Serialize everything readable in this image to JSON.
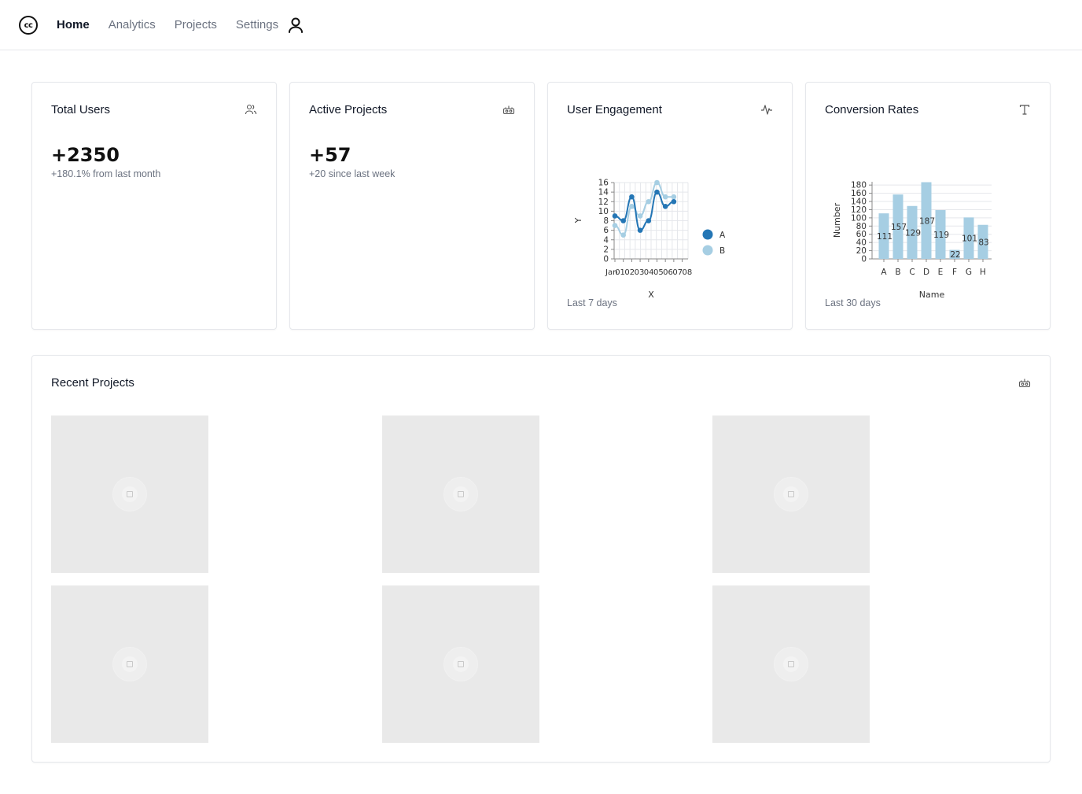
{
  "logo": {
    "text": "cc"
  },
  "nav": {
    "items": [
      {
        "label": "Home",
        "active": true
      },
      {
        "label": "Analytics",
        "active": false
      },
      {
        "label": "Projects",
        "active": false
      },
      {
        "label": "Settings",
        "active": false
      }
    ]
  },
  "cards": {
    "total_users": {
      "title": "Total Users",
      "value": "+2350",
      "sub": "+180.1% from last month",
      "icon": "users-icon"
    },
    "active_projects": {
      "title": "Active Projects",
      "value": "+57",
      "sub": "+20 since last week",
      "icon": "projects-icon"
    },
    "user_engagement": {
      "title": "User Engagement",
      "foot": "Last 7 days",
      "icon": "activity-icon"
    },
    "conversion_rates": {
      "title": "Conversion Rates",
      "foot": "Last 30 days",
      "icon": "type-icon"
    }
  },
  "recent_projects": {
    "title": "Recent Projects",
    "icon": "projects-icon",
    "count": 6
  },
  "colors": {
    "series_a": "#2476b5",
    "series_b": "#a6cee3",
    "bar": "#a6cee3"
  },
  "chart_data": [
    {
      "type": "line",
      "xlabel": "X",
      "ylabel": "Y",
      "x": [
        "Jan",
        "01",
        "02",
        "03",
        "04",
        "05",
        "06",
        "07",
        "08"
      ],
      "ylim": [
        0,
        16
      ],
      "yticks": [
        0,
        2,
        4,
        6,
        8,
        10,
        12,
        14,
        16
      ],
      "grid": true,
      "legend": "right",
      "series": [
        {
          "name": "A",
          "values": [
            9,
            8,
            13,
            6,
            8,
            14,
            11,
            12
          ]
        },
        {
          "name": "B",
          "values": [
            7,
            5,
            11,
            9,
            12,
            16,
            13,
            13
          ]
        }
      ]
    },
    {
      "type": "bar",
      "xlabel": "Name",
      "ylabel": "Number",
      "categories": [
        "A",
        "B",
        "C",
        "D",
        "E",
        "F",
        "G",
        "H"
      ],
      "values": [
        111,
        157,
        129,
        187,
        119,
        22,
        101,
        83
      ],
      "ylim": [
        0,
        180
      ],
      "yticks": [
        0,
        20,
        40,
        60,
        80,
        100,
        120,
        140,
        160,
        180
      ],
      "grid": true
    }
  ]
}
